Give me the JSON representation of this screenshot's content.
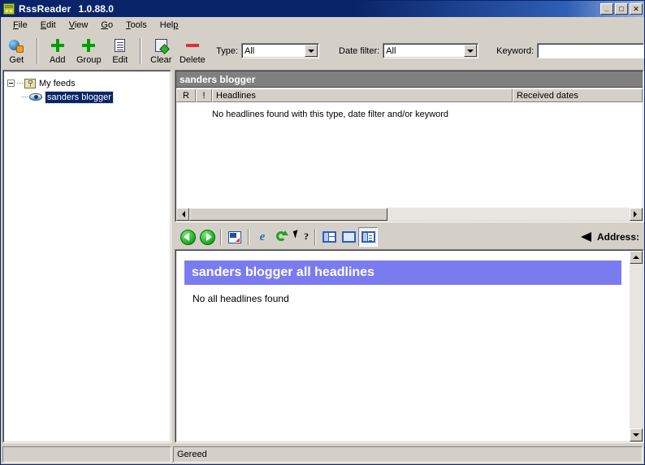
{
  "window": {
    "title": "RssReader",
    "version": "1.0.88.0",
    "icon": "app-icon",
    "buttons": {
      "minimize": "_",
      "maximize": "□",
      "close": "✕"
    }
  },
  "menubar": {
    "items": [
      {
        "label": "File",
        "accel": "F"
      },
      {
        "label": "Edit",
        "accel": "E"
      },
      {
        "label": "View",
        "accel": "V"
      },
      {
        "label": "Go",
        "accel": "G"
      },
      {
        "label": "Tools",
        "accel": "T"
      },
      {
        "label": "Help",
        "accel": "H"
      }
    ]
  },
  "toolbar": {
    "buttons": [
      {
        "label": "Get",
        "icon": "get-feed-icon"
      },
      {
        "label": "Add",
        "icon": "plus-icon"
      },
      {
        "label": "Group",
        "icon": "plus-icon"
      },
      {
        "label": "Edit",
        "icon": "document-icon"
      },
      {
        "label": "Clear",
        "icon": "clear-icon"
      },
      {
        "label": "Delete",
        "icon": "minus-icon"
      }
    ],
    "filters": {
      "type_label": "Type:",
      "type_value": "All",
      "date_label": "Date filter:",
      "date_value": "All",
      "keyword_label": "Keyword:",
      "keyword_value": "",
      "keyword_placeholder": ""
    }
  },
  "tree": {
    "root": {
      "label": "My feeds",
      "icon": "folder-icon",
      "expanded": true
    },
    "children": [
      {
        "label": "sanders blogger",
        "icon": "feed-icon",
        "selected": true
      }
    ]
  },
  "headlines": {
    "title": "sanders blogger",
    "columns": [
      "R",
      "!",
      "Headlines",
      "Received dates"
    ],
    "rows": [],
    "empty_message": "No headlines found with this type, date filter and/or keyword"
  },
  "browser_toolbar": {
    "buttons": [
      {
        "icon": "back-arrow-icon",
        "label": "Back"
      },
      {
        "icon": "forward-arrow-icon",
        "label": "Forward"
      },
      {
        "icon": "open-external-icon",
        "label": "Open"
      },
      {
        "icon": "internet-explorer-icon",
        "label": "Browser"
      },
      {
        "icon": "refresh-icon",
        "label": "Refresh"
      },
      {
        "icon": "help-cursor-icon",
        "label": "What's this"
      },
      {
        "icon": "layout-split-icon",
        "label": "Layout split",
        "active": false
      },
      {
        "icon": "layout-full-icon",
        "label": "Layout full",
        "active": false
      },
      {
        "icon": "layout-detail-icon",
        "label": "Layout detail",
        "active": true
      }
    ],
    "address_label": "Address:",
    "address_icon": "left-triangle-icon"
  },
  "content": {
    "heading": "sanders blogger all headlines",
    "body": "No all headlines found"
  },
  "statusbar": {
    "left": "",
    "right": "Gereed"
  },
  "colors": {
    "titlebar": "#0a246a",
    "face": "#d4d0c8",
    "panel_header": "#808080",
    "selection": "#0a246a",
    "content_heading": "#7b7bf0",
    "accent_green": "#00a000",
    "accent_red": "#e03030"
  }
}
